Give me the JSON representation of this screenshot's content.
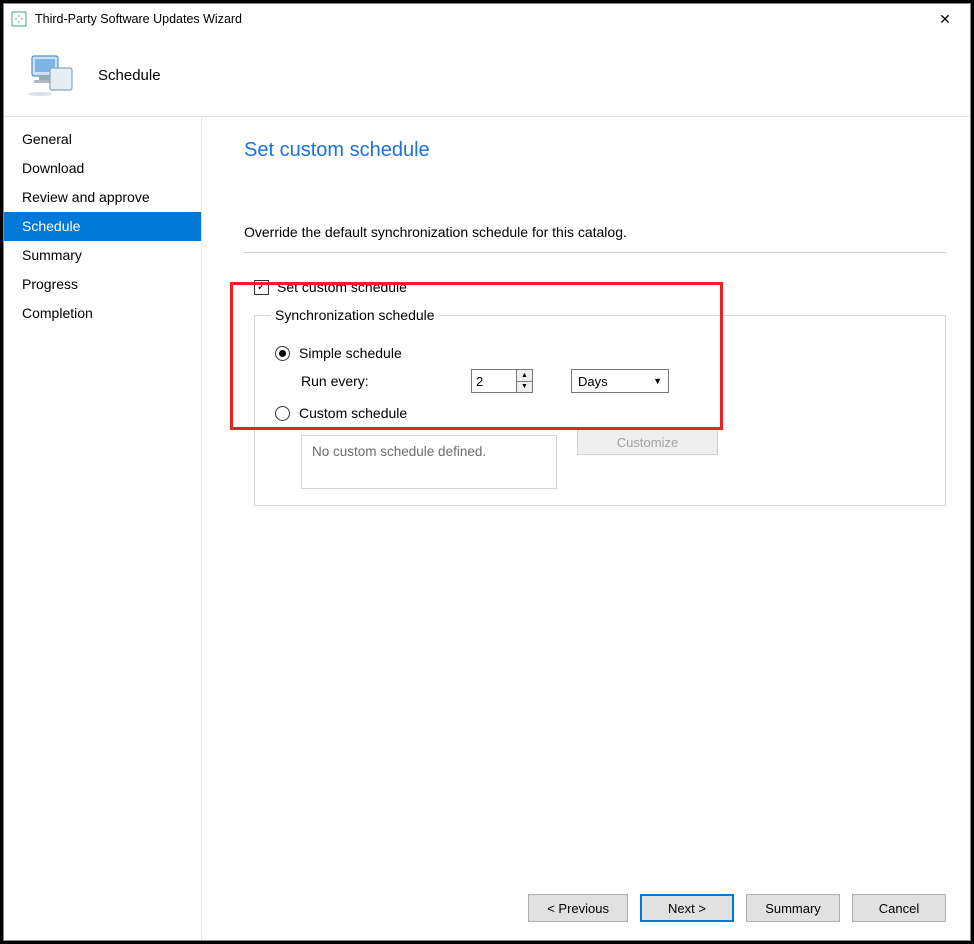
{
  "titlebar": {
    "title": "Third-Party Software Updates Wizard"
  },
  "header": {
    "label": "Schedule"
  },
  "sidebar": {
    "items": [
      {
        "label": "General"
      },
      {
        "label": "Download"
      },
      {
        "label": "Review and approve"
      },
      {
        "label": "Schedule"
      },
      {
        "label": "Summary"
      },
      {
        "label": "Progress"
      },
      {
        "label": "Completion"
      }
    ],
    "selected_index": 3
  },
  "main": {
    "page_title": "Set custom schedule",
    "instruction": "Override the default synchronization schedule for this catalog.",
    "set_custom_checkbox": {
      "label": "Set custom schedule",
      "checked": true
    },
    "group_legend": "Synchronization schedule",
    "simple_radio": {
      "label": "Simple schedule",
      "checked": true
    },
    "run_every_label": "Run every:",
    "run_every_value": "2",
    "run_every_unit": "Days",
    "custom_radio": {
      "label": "Custom schedule",
      "checked": false
    },
    "no_custom_text": "No custom schedule defined.",
    "customize_btn": "Customize"
  },
  "footer": {
    "previous": "< Previous",
    "next": "Next >",
    "summary": "Summary",
    "cancel": "Cancel"
  }
}
